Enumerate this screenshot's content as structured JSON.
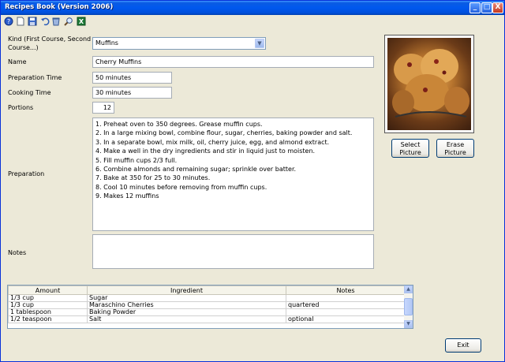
{
  "window": {
    "title": "Recipes Book (Version 2006)",
    "minimize": "_",
    "maximize": "□",
    "close": "X"
  },
  "toolbar": [
    "help-icon",
    "new-icon",
    "save-icon",
    "undo-icon",
    "delete-icon",
    "search-icon",
    "excel-icon"
  ],
  "form": {
    "kind_label": "Kind (First Course, Second\nCourse...)",
    "kind_value": "Muffins",
    "name_label": "Name",
    "name_value": "Cherry Muffins",
    "prep_time_label": "Preparation Time",
    "prep_time_value": "50 minutes",
    "cook_time_label": "Cooking Time",
    "cook_time_value": "30 minutes",
    "portions_label": "Portions",
    "portions_value": "12",
    "preparation_label": "Preparation",
    "preparation_lines": [
      "1. Preheat oven to 350 degrees. Grease muffin cups.",
      "2. In a large mixing bowl, combine flour, sugar, cherries, baking powder and salt.",
      "3. In a separate bowl, mix milk, oil, cherry juice, egg, and almond extract.",
      "4. Make a well in the dry ingredients and stir in liquid just to moisten.",
      "5. Fill muffin cups 2/3 full.",
      "6. Combine almonds and remaining sugar; sprinkle over batter.",
      "7. Bake at 350 for 25 to 30 minutes.",
      "8. Cool 10 minutes before removing from muffin cups.",
      "9. Makes 12 muffins"
    ],
    "notes_label": "Notes",
    "notes_value": ""
  },
  "picture": {
    "select_label": "Select\nPicture",
    "erase_label": "Erase\nPicture"
  },
  "ingredients": {
    "columns": [
      "Amount",
      "Ingredient",
      "Notes"
    ],
    "rows": [
      [
        "1/3 cup",
        "Sugar",
        ""
      ],
      [
        "1/3 cup",
        "Maraschino Cherries",
        "quartered"
      ],
      [
        "1 tablespoon",
        "Baking Powder",
        ""
      ],
      [
        "1/2 teaspoon",
        "Salt",
        "optional"
      ]
    ]
  },
  "exit_label": "Exit"
}
